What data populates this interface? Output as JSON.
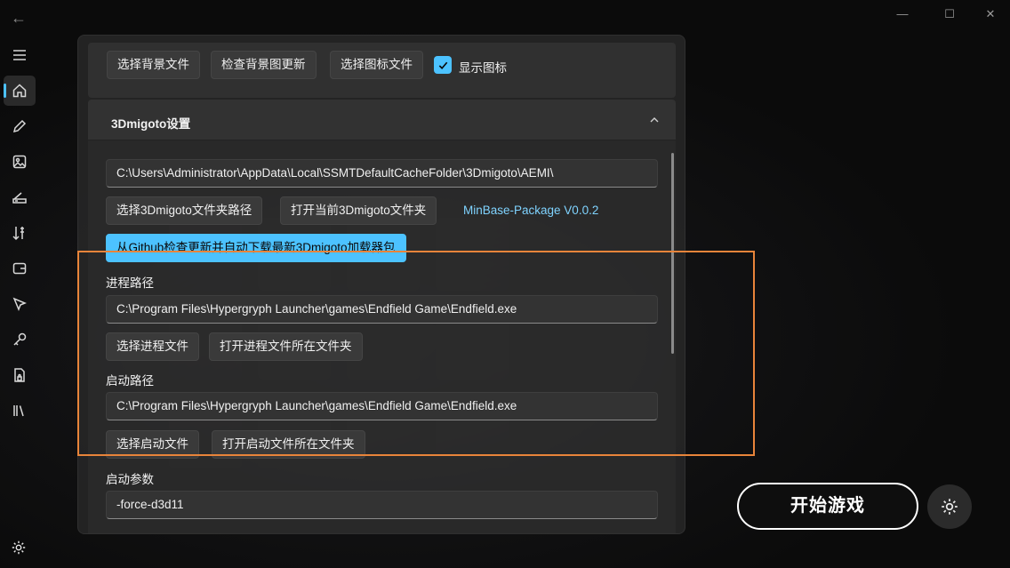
{
  "window": {
    "back_icon": "←",
    "minimize_icon": "—",
    "maximize_icon": "☐",
    "close_icon": "✕"
  },
  "sidebar": {
    "items": [
      {
        "icon": "menu-icon"
      },
      {
        "icon": "home-icon",
        "active": true
      },
      {
        "icon": "pencil-icon"
      },
      {
        "icon": "image-icon"
      },
      {
        "icon": "scanner-icon"
      },
      {
        "icon": "sort-icon"
      },
      {
        "icon": "wallet-icon"
      },
      {
        "icon": "touch-icon"
      },
      {
        "icon": "key-icon"
      },
      {
        "icon": "lock-file-icon"
      },
      {
        "icon": "library-icon"
      },
      {
        "icon": "gear-icon"
      }
    ]
  },
  "top_card": {
    "select_bg_label": "选择背景文件",
    "check_bg_update_label": "检查背景图更新",
    "select_icon_label": "选择图标文件",
    "show_icon_label": "显示图标",
    "show_icon_checked": true
  },
  "migoto": {
    "header": "3Dmigoto设置",
    "folder_path": "C:\\Users\\Administrator\\AppData\\Local\\SSMTDefaultCacheFolder\\3Dmigoto\\AEMI\\",
    "select_folder_label": "选择3Dmigoto文件夹路径",
    "open_folder_label": "打开当前3Dmigoto文件夹",
    "package_version": "MinBase-Package V0.0.2",
    "update_label": "从Github检查更新并自动下载最新3Dmigoto加载器包"
  },
  "process": {
    "label": "进程路径",
    "path": "C:\\Program Files\\Hypergryph Launcher\\games\\Endfield Game\\Endfield.exe",
    "select_label": "选择进程文件",
    "open_label": "打开进程文件所在文件夹"
  },
  "launch": {
    "label": "启动路径",
    "path": "C:\\Program Files\\Hypergryph Launcher\\games\\Endfield Game\\Endfield.exe",
    "select_label": "选择启动文件",
    "open_label": "打开启动文件所在文件夹"
  },
  "args": {
    "label": "启动参数",
    "value": "-force-d3d11"
  },
  "footer": {
    "start_label": "开始游戏"
  },
  "colors": {
    "accent": "#4cc2ff",
    "highlight": "#e8843a"
  }
}
